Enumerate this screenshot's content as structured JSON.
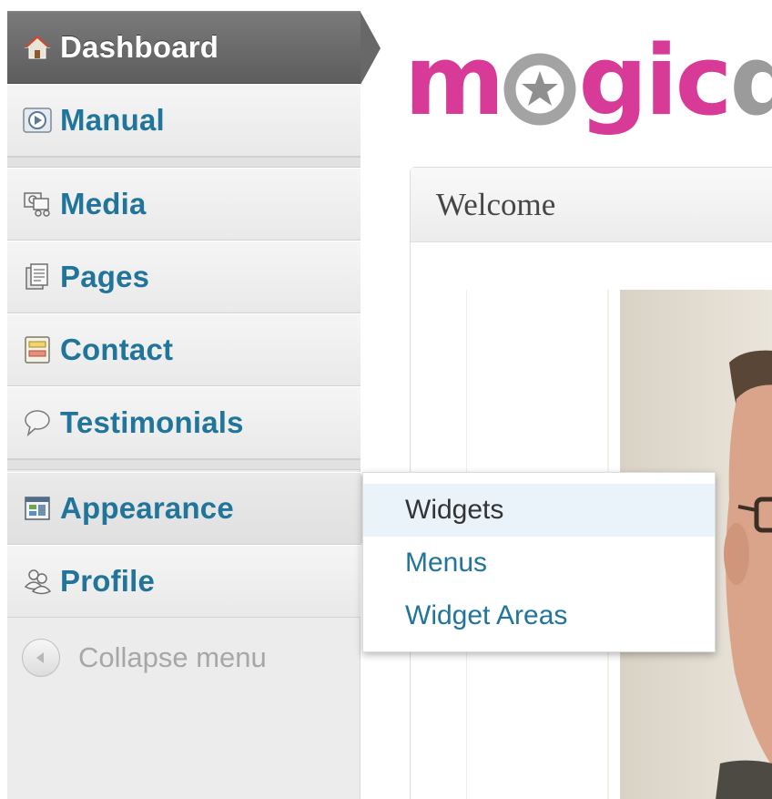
{
  "sidebar": {
    "items": [
      {
        "label": "Dashboard",
        "icon": "home-icon"
      },
      {
        "label": "Manual",
        "icon": "play-icon"
      },
      {
        "label": "Media",
        "icon": "media-icon"
      },
      {
        "label": "Pages",
        "icon": "pages-icon"
      },
      {
        "label": "Contact",
        "icon": "contact-form-icon"
      },
      {
        "label": "Testimonials",
        "icon": "speech-bubble-icon"
      },
      {
        "label": "Appearance",
        "icon": "appearance-icon"
      },
      {
        "label": "Profile",
        "icon": "users-icon"
      }
    ],
    "collapse_label": "Collapse menu"
  },
  "flyout": {
    "items": [
      {
        "label": "Widgets"
      },
      {
        "label": "Menus"
      },
      {
        "label": "Widget Areas"
      }
    ]
  },
  "logo": {
    "part1": "m",
    "part2": "gic",
    "part3": "d"
  },
  "panel": {
    "title": "Welcome"
  },
  "colors": {
    "menu_link": "#21759b",
    "current_bg": "#686868",
    "logo_pink": "#d83a97",
    "logo_grey": "#9b9b9b",
    "collapse_text": "#a7a7a7"
  }
}
